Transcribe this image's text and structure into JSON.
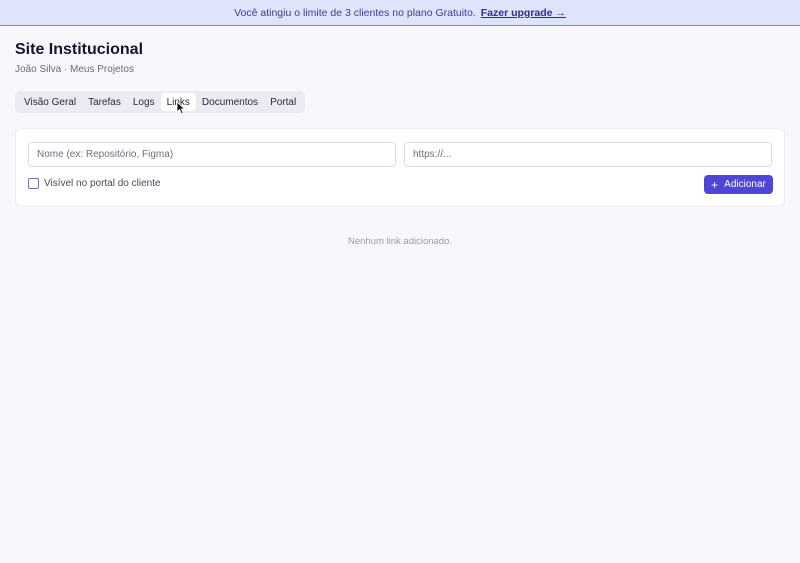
{
  "banner": {
    "message": "Você atingiu o limite de 3 clientes no plano Gratuito.",
    "upgrade_link": "Fazer upgrade →"
  },
  "header": {
    "title": "Site Institucional",
    "subtitle": "João Silva · Meus Projetos"
  },
  "tabs": [
    {
      "label": "Visão Geral"
    },
    {
      "label": "Tarefas"
    },
    {
      "label": "Logs"
    },
    {
      "label": "Links",
      "active": true
    },
    {
      "label": "Documentos"
    },
    {
      "label": "Portal"
    }
  ],
  "form": {
    "name_placeholder": "Nome (ex: Repositório, Figma)",
    "url_placeholder": "https://...",
    "checkbox_label": "Visível no portal do cliente",
    "checkbox_checked": false,
    "add_button_label": "Adicionar",
    "add_button_icon": "plus-icon"
  },
  "empty_state": "Nenhum link adicionado.",
  "colors": {
    "accent": "#4f46d8",
    "banner_bg": "#e0e4fb",
    "page_bg": "#f7f7fc"
  }
}
